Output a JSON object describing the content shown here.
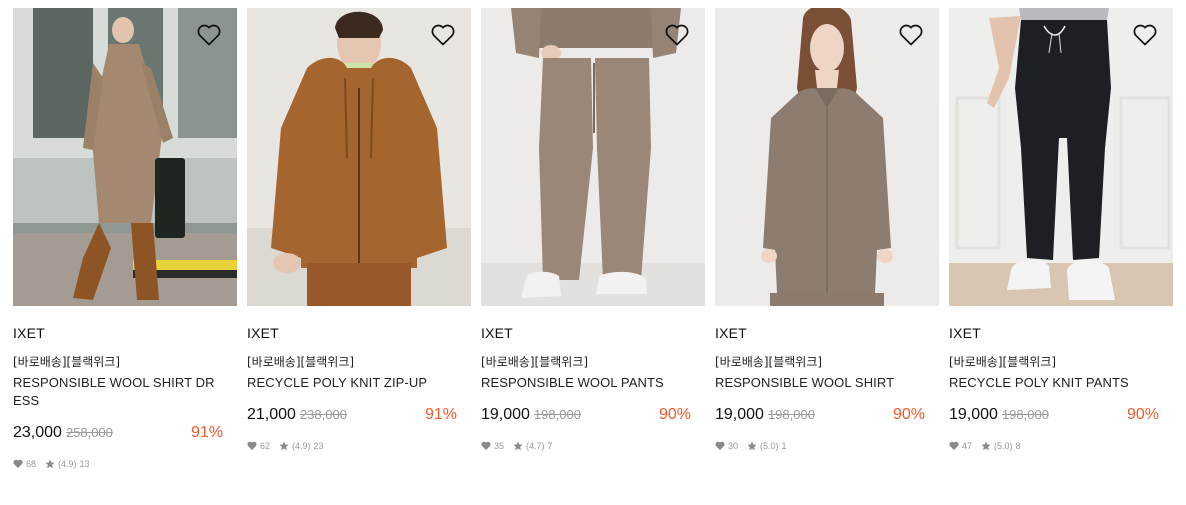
{
  "products": [
    {
      "brand": "IXET",
      "tag": "[바로배송][블랙위크]",
      "name": "RESPONSIBLE WOOL SHIRT DRESS",
      "price": "23,000",
      "original_price": "258,000",
      "discount": "91%",
      "likes": "68",
      "rating": "(4.9)",
      "reviews": "13",
      "image": "model-wool-shirt-dress"
    },
    {
      "brand": "IXET",
      "tag": "[바로배송][블랙위크]",
      "name": "RECYCLE POLY KNIT ZIP-UP",
      "price": "21,000",
      "original_price": "238,000",
      "discount": "91%",
      "likes": "62",
      "rating": "(4.9)",
      "reviews": "23",
      "image": "model-knit-zip-up"
    },
    {
      "brand": "IXET",
      "tag": "[바로배송][블랙위크]",
      "name": "RESPONSIBLE WOOL PANTS",
      "price": "19,000",
      "original_price": "198,000",
      "discount": "90%",
      "likes": "35",
      "rating": "(4.7)",
      "reviews": "7",
      "image": "model-wool-pants"
    },
    {
      "brand": "IXET",
      "tag": "[바로배송][블랙위크]",
      "name": "RESPONSIBLE WOOL SHIRT",
      "price": "19,000",
      "original_price": "198,000",
      "discount": "90%",
      "likes": "30",
      "rating": "(5.0)",
      "reviews": "1",
      "image": "model-wool-shirt"
    },
    {
      "brand": "IXET",
      "tag": "[바로배송][블랙위크]",
      "name": "RECYCLE POLY KNIT PANTS",
      "price": "19,000",
      "original_price": "198,000",
      "discount": "90%",
      "likes": "47",
      "rating": "(5.0)",
      "reviews": "8",
      "image": "model-knit-pants"
    }
  ],
  "colors": {
    "discount": "#ee5a2c",
    "muted": "#999999",
    "text": "#222222"
  }
}
